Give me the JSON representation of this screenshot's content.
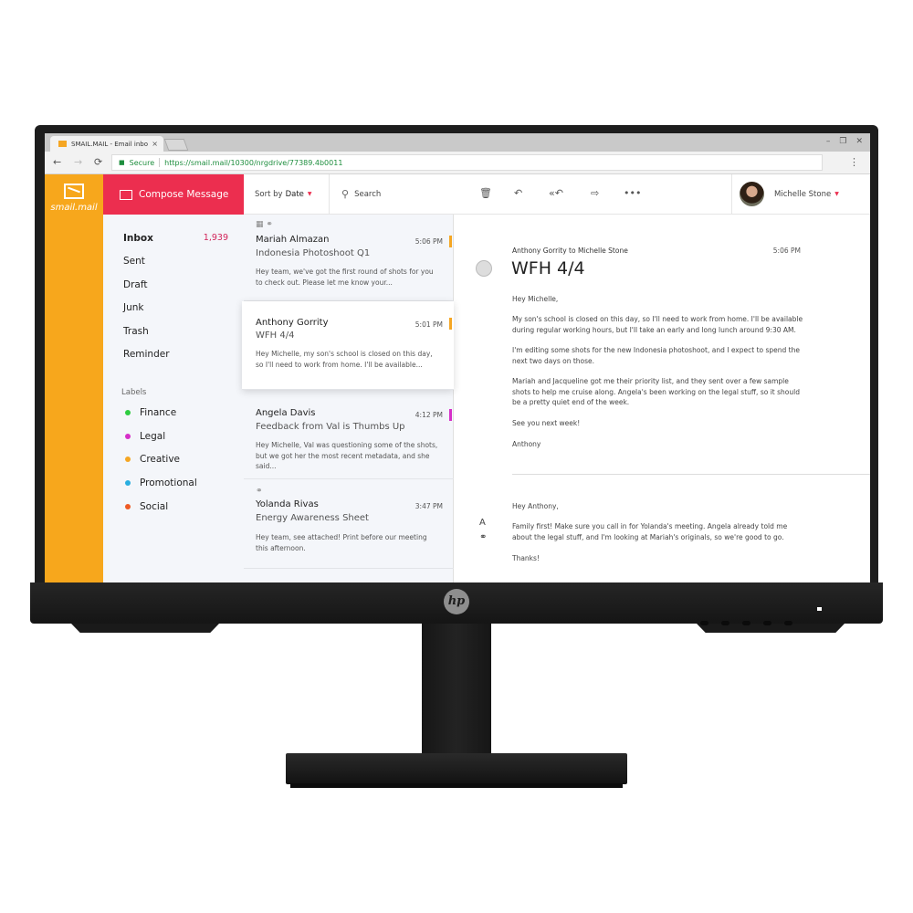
{
  "browser": {
    "tab_title": "SMAIL.MAIL - Email inbo",
    "tab_close": "×",
    "window_controls": [
      "–",
      "❐",
      "✕"
    ],
    "nav": {
      "back": "←",
      "forward": "→",
      "reload": "⟳"
    },
    "secure_label": "Secure",
    "url": "https://smail.mail/10300/nrgdrive/77389.4b0011",
    "menu": "⋮"
  },
  "app": {
    "brand": "smail.mail",
    "compose_label": "Compose Message",
    "sort": {
      "prefix": "Sort by",
      "value": "Date",
      "caret": "▼"
    },
    "search_label": "Search",
    "toolbar_icons": [
      "trash-icon",
      "reply-icon",
      "reply-all-icon",
      "forward-icon",
      "more-icon"
    ],
    "toolbar_glyphs": [
      "🗑",
      "↶",
      "«↶",
      "⇨",
      "•••"
    ],
    "user": {
      "name": "Michelle Stone",
      "caret": "▼"
    }
  },
  "folders": [
    {
      "label": "Inbox",
      "count": "1,939"
    },
    {
      "label": "Sent"
    },
    {
      "label": "Draft"
    },
    {
      "label": "Junk"
    },
    {
      "label": "Trash"
    },
    {
      "label": "Reminder"
    }
  ],
  "labels_heading": "Labels",
  "labels": [
    {
      "label": "Finance",
      "color": "#2ecc40"
    },
    {
      "label": "Legal",
      "color": "#d62fc8"
    },
    {
      "label": "Creative",
      "color": "#f5a623"
    },
    {
      "label": "Promotional",
      "color": "#29aee0"
    },
    {
      "label": "Social",
      "color": "#ee5a24"
    }
  ],
  "messages": [
    {
      "icons": "▦ ⚭",
      "from": "Mariah Almazan",
      "subject": "Indonesia Photoshoot Q1",
      "time": "5:06 PM",
      "tag_color": "#f5a623",
      "preview": "Hey team, we've got the first round of shots for you to check out. Please let me know your..."
    },
    {
      "icons": "",
      "from": "Anthony Gorrity",
      "subject": "WFH 4/4",
      "time": "5:01 PM",
      "tag_color": "#f5a623",
      "preview": "Hey Michelle, my son's school is closed on this day, so I'll need to work from home. I'll be available..."
    },
    {
      "icons": "",
      "from": "Angela Davis",
      "subject": "Feedback from Val is Thumbs Up",
      "time": "4:12 PM",
      "tag_color": "#d62fc8",
      "preview": "Hey Michelle, Val was questioning some of the shots, but we got her the most recent metadata, and she said..."
    },
    {
      "icons": "⚭",
      "from": "Yolanda Rivas",
      "subject": "Energy Awareness Sheet",
      "time": "3:47 PM",
      "tag_color": "",
      "preview": "Hey team, see attached! Print before our meeting this afternoon."
    }
  ],
  "reader": {
    "sender_line": "Anthony Gorrity to Michelle Stone",
    "time": "5:06 PM",
    "subject": "WFH 4/4",
    "body": [
      "Hey Michelle,",
      "My son's school is closed on this day, so I'll need to work from home. I'll be available during regular working hours, but I'll take an early and long lunch around 9:30 AM.",
      "I'm editing some shots for the new Indonesia photoshoot, and I expect to spend the next two days on those.",
      "Mariah and Jacqueline got me their priority list, and they sent over a few sample shots to help me cruise along. Angela's been working on the legal stuff, so it should be a pretty quiet end of the week.",
      "See you next week!",
      "Anthony"
    ],
    "reply_tools": [
      "A",
      "⚭"
    ],
    "reply": [
      "Hey Anthony,",
      "Family first! Make sure you call in for Yolanda's meeting. Angela already told me about the legal stuff, and I'm looking at Mariah's originals, so we're good to go.",
      "Thanks!"
    ]
  },
  "monitor": {
    "logo": "hp"
  }
}
